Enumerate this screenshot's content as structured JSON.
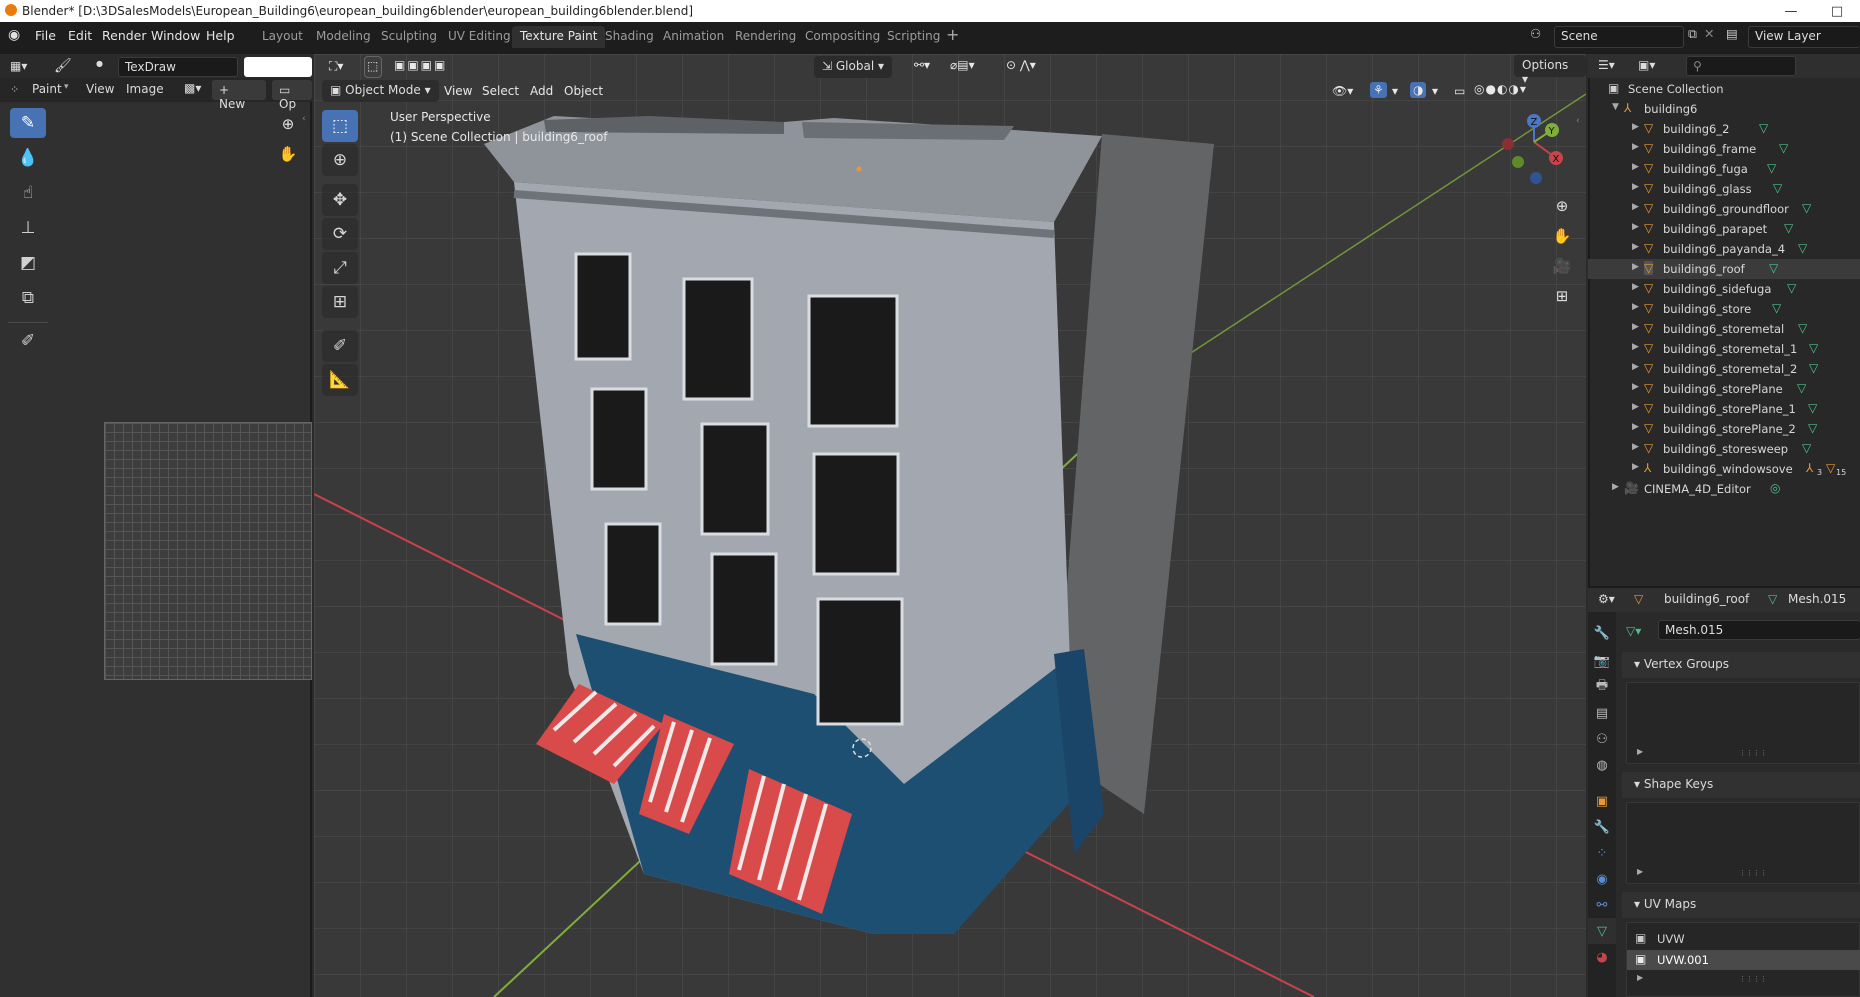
{
  "window": {
    "title": "Blender* [D:\\3DSalesModels\\European_Building6\\european_building6blender\\european_building6blender.blend]",
    "minimize": "—",
    "maximize": "□"
  },
  "menu": {
    "items": [
      "File",
      "Edit",
      "Render",
      "Window",
      "Help"
    ]
  },
  "workspace_tabs": [
    "Layout",
    "Modeling",
    "Sculpting",
    "UV Editing",
    "Texture Paint",
    "Shading",
    "Animation",
    "Rendering",
    "Compositing",
    "Scripting"
  ],
  "active_tab": "Texture Paint",
  "scene": {
    "label": "Scene",
    "view_layer": "View Layer"
  },
  "left_panel": {
    "brush_name": "TexDraw",
    "mode": "Paint",
    "menus": [
      "View",
      "Image"
    ],
    "new_label": "New",
    "open_label": "Op"
  },
  "viewport": {
    "mode": "Object Mode",
    "menus": [
      "View",
      "Select",
      "Add",
      "Object"
    ],
    "transform_orientation": "Global",
    "options": "Options",
    "perspective": "User Perspective",
    "collection_info": "(1) Scene Collection | building6_roof",
    "axes": {
      "x": "X",
      "y": "Y",
      "z": "Z"
    }
  },
  "outliner": {
    "root": "Scene Collection",
    "collection": "building6",
    "items": [
      "building6_2",
      "building6_frame",
      "building6_fuga",
      "building6_glass",
      "building6_groundfloor",
      "building6_parapet",
      "building6_payanda_4",
      "building6_roof",
      "building6_sidefuga",
      "building6_store",
      "building6_storemetal",
      "building6_storemetal_1",
      "building6_storemetal_2",
      "building6_storePlane",
      "building6_storePlane_1",
      "building6_storePlane_2",
      "building6_storesweep",
      "building6_windowsove"
    ],
    "windowsove_counts": {
      "a": "3",
      "b": "15"
    },
    "extra": "CINEMA_4D_Editor"
  },
  "properties": {
    "object": "building6_roof",
    "mesh": "Mesh.015",
    "mesh_field": "Mesh.015",
    "panels": {
      "vertex_groups": "Vertex Groups",
      "shape_keys": "Shape Keys",
      "uv_maps": "UV Maps"
    },
    "uv_maps": [
      "UVW",
      "UVW.001"
    ]
  },
  "colors": {
    "accent": "#4772b3",
    "object_orange": "#e8973a",
    "mesh_green": "#4fc08d",
    "x_axis": "#c9434b",
    "y_axis": "#7fae3a"
  }
}
